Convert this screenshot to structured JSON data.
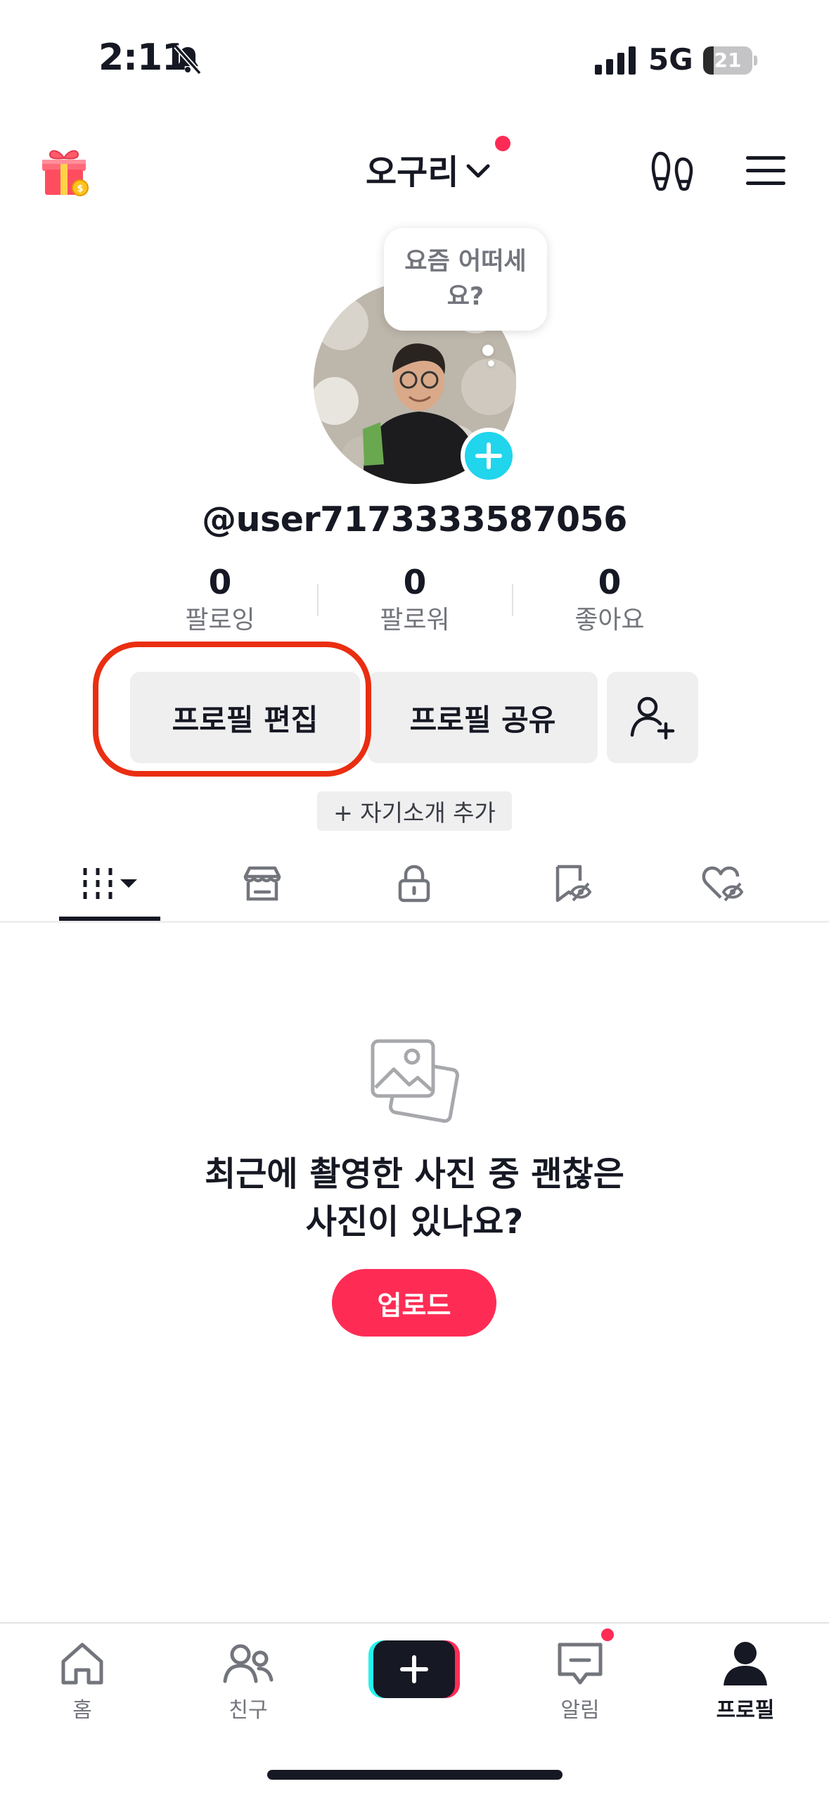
{
  "status_bar": {
    "time": "2:11",
    "network": "5G",
    "battery": "21",
    "battery_level": 0.21
  },
  "header": {
    "account_name": "오구리"
  },
  "avatar": {
    "bubble_text": "요즘 어떠세요?"
  },
  "profile": {
    "username": "@user7173333587056"
  },
  "stats": [
    {
      "value": "0",
      "label": "팔로잉"
    },
    {
      "value": "0",
      "label": "팔로워"
    },
    {
      "value": "0",
      "label": "좋아요"
    }
  ],
  "actions": {
    "edit_profile": "프로필 편집",
    "share_profile": "프로필 공유",
    "add_bio": "+ 자기소개 추가"
  },
  "tabs": [
    {
      "icon": "grid-icon",
      "active": true
    },
    {
      "icon": "shop-icon"
    },
    {
      "icon": "lock-icon"
    },
    {
      "icon": "bookmark-icon"
    },
    {
      "icon": "heart-hidden-icon"
    }
  ],
  "empty_state": {
    "title": "최근에 촬영한 사진 중 괜찮은\n사진이 있나요?",
    "upload_label": "업로드"
  },
  "bottom_nav": [
    {
      "label": "홈",
      "icon": "home-icon"
    },
    {
      "label": "친구",
      "icon": "friends-icon"
    },
    {
      "label": "",
      "icon": "create-plus-icon"
    },
    {
      "label": "알림",
      "icon": "inbox-icon"
    },
    {
      "label": "프로필",
      "icon": "profile-icon",
      "active": true
    }
  ],
  "colors": {
    "accent": "#fe2c55",
    "cyan": "#25f4ee",
    "highlight": "#ea2e11",
    "avatar_plus": "#20d5ec"
  }
}
